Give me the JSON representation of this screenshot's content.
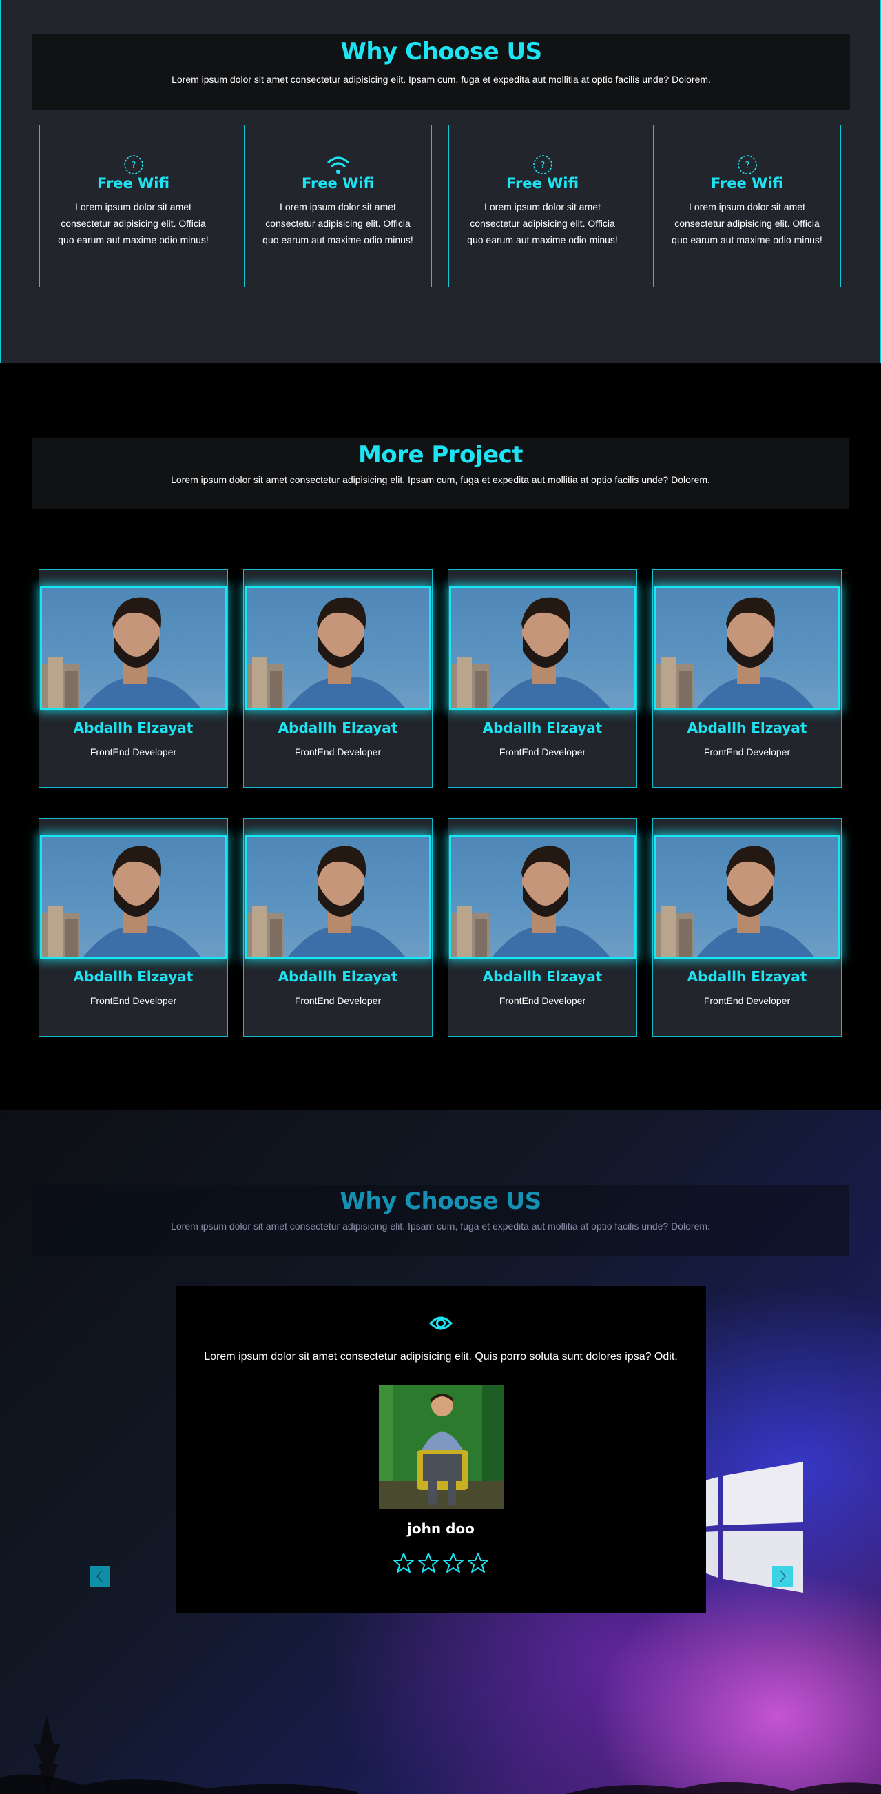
{
  "why_section": {
    "title": "Why Choose US",
    "subtitle": "Lorem ipsum dolor sit amet consectetur adipisicing elit. Ipsam cum, fuga et expedita aut mollitia at optio facilis unde? Dolorem.",
    "features": [
      {
        "icon": "question-circle-icon",
        "title": "Free Wifi",
        "desc": "Lorem ipsum dolor sit amet consectetur adipisicing elit. Officia quo earum aut maxime odio minus!"
      },
      {
        "icon": "wifi-icon",
        "title": "Free Wifi",
        "desc": "Lorem ipsum dolor sit amet consectetur adipisicing elit. Officia quo earum aut maxime odio minus!"
      },
      {
        "icon": "question-circle-icon",
        "title": "Free Wifi",
        "desc": "Lorem ipsum dolor sit amet consectetur adipisicing elit. Officia quo earum aut maxime odio minus!"
      },
      {
        "icon": "question-circle-icon",
        "title": "Free Wifi",
        "desc": "Lorem ipsum dolor sit amet consectetur adipisicing elit. Officia quo earum aut maxime odio minus!"
      }
    ]
  },
  "projects_section": {
    "title": "More Project",
    "subtitle": "Lorem ipsum dolor sit amet consectetur adipisicing elit. Ipsam cum, fuga et expedita aut mollitia at optio facilis unde? Dolorem.",
    "members": [
      {
        "name": "Abdallh Elzayat",
        "role": "FrontEnd Developer"
      },
      {
        "name": "Abdallh Elzayat",
        "role": "FrontEnd Developer"
      },
      {
        "name": "Abdallh Elzayat",
        "role": "FrontEnd Developer"
      },
      {
        "name": "Abdallh Elzayat",
        "role": "FrontEnd Developer"
      },
      {
        "name": "Abdallh Elzayat",
        "role": "FrontEnd Developer"
      },
      {
        "name": "Abdallh Elzayat",
        "role": "FrontEnd Developer"
      },
      {
        "name": "Abdallh Elzayat",
        "role": "FrontEnd Developer"
      },
      {
        "name": "Abdallh Elzayat",
        "role": "FrontEnd Developer"
      }
    ]
  },
  "testimonials_section": {
    "title": "Why Choose US",
    "subtitle": "Lorem ipsum dolor sit amet consectetur adipisicing elit. Ipsam cum, fuga et expedita aut mollitia at optio facilis unde? Dolorem.",
    "quote": "Lorem ipsum dolor sit amet consectetur adipisicing elit. Quis porro soluta sunt dolores ipsa? Odit.",
    "author": "john doo",
    "rating_stars": 4,
    "quote_icon": "eye-icon",
    "prev_icon": "chevron-left-icon",
    "next_icon": "chevron-right-icon"
  },
  "colors": {
    "accent": "#1ee3f2",
    "border": "#13c6d6",
    "card_bg": "#22252b",
    "heading_bg": "#111214"
  }
}
